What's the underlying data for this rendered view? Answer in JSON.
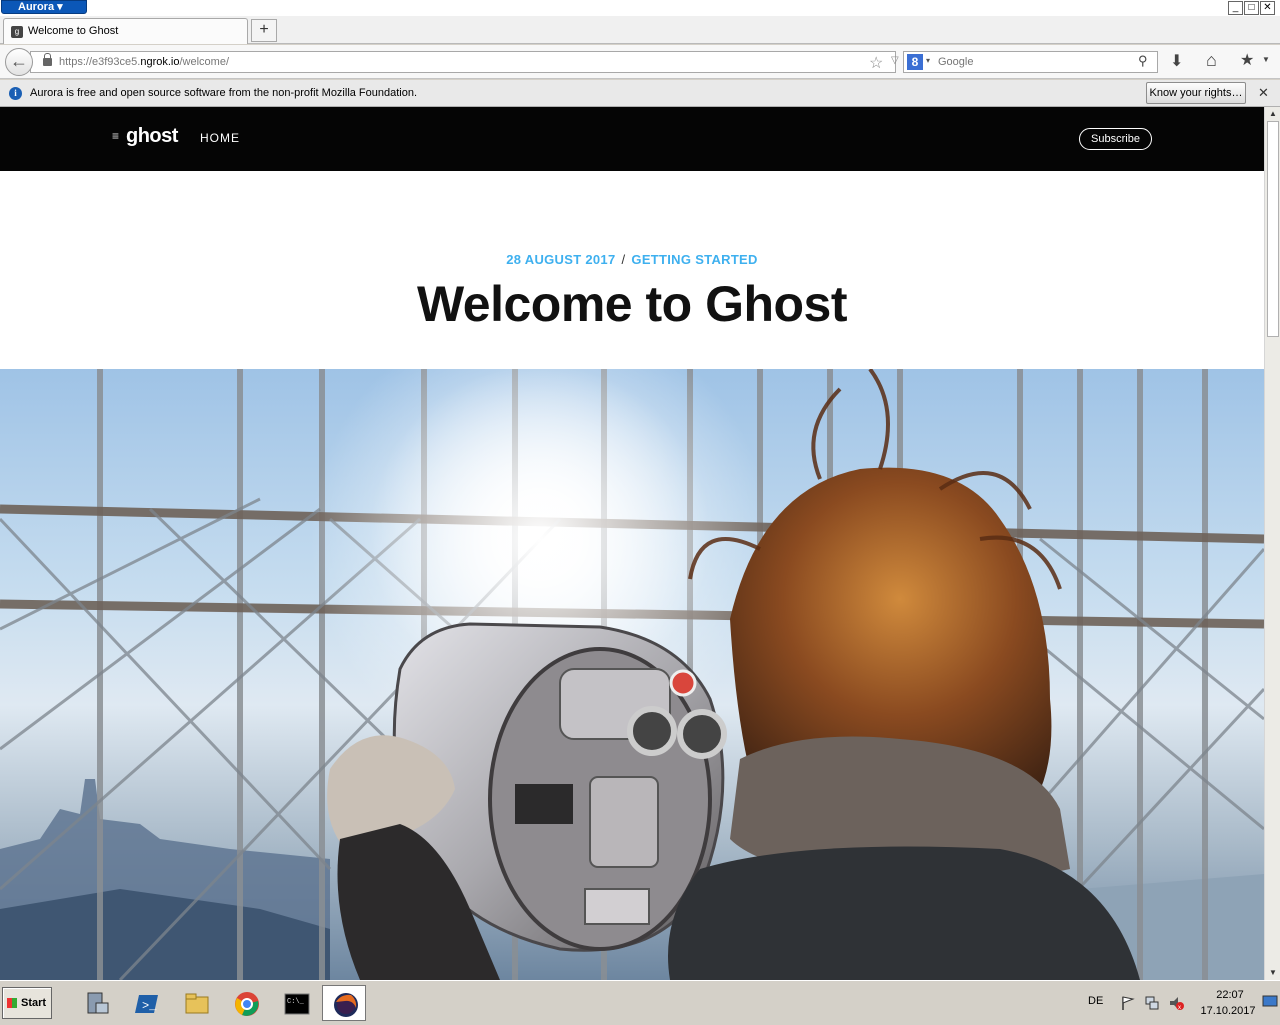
{
  "window": {
    "app_menu_label": "Aurora",
    "minimize": "_",
    "maximize": "□",
    "close": "✕"
  },
  "tabs": [
    {
      "title": "Welcome to Ghost"
    }
  ],
  "new_tab_label": "+",
  "navbar": {
    "url_prefix": "https://e3f93ce5.",
    "url_host": "ngrok.io",
    "url_path": "/welcome/",
    "search_engine": "Google",
    "search_placeholder": "Google"
  },
  "notification": {
    "text": "Aurora is free and open source software from the non-profit Mozilla Foundation.",
    "button_label": "Know your rights…"
  },
  "site": {
    "logo": "ghost",
    "nav_home": "HOME",
    "subscribe_label": "Subscribe",
    "post_date": "28 AUGUST 2017",
    "post_separator": "/",
    "post_tag": "GETTING STARTED",
    "post_title": "Welcome to Ghost"
  },
  "taskbar": {
    "start_label": "Start",
    "lang": "DE",
    "time": "22:07",
    "date": "17.10.2017"
  },
  "icons": {
    "server_manager": "server-icon",
    "powershell": "powershell-icon",
    "explorer": "folder-icon",
    "chrome": "chrome-icon",
    "cmd": "cmd-icon",
    "firefox": "firefox-icon"
  }
}
